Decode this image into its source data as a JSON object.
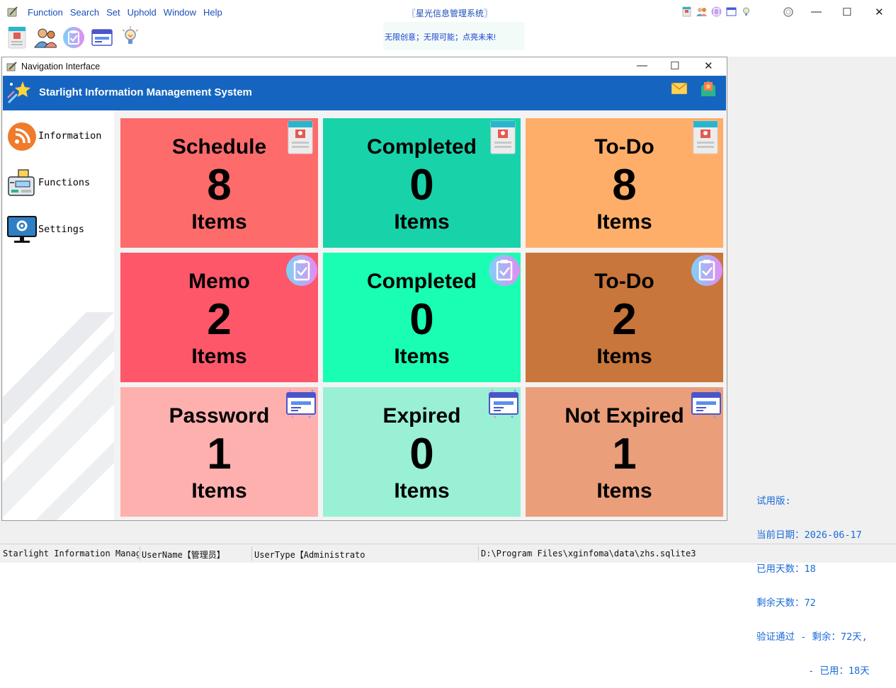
{
  "menu": [
    "Function",
    "Search",
    "Set",
    "Uphold",
    "Window",
    "Help"
  ],
  "app_title": "〖星光信息管理系统〗",
  "slogan": "无限创意；无限可能；点亮未来!",
  "window_controls": {
    "minimize": "—",
    "maximize": "☐",
    "close": "✕"
  },
  "toolbar_icons": [
    "id-card-icon",
    "users-icon",
    "clipboard-check-icon",
    "browser-window-icon",
    "lightbulb-icon"
  ],
  "child": {
    "title": "Navigation Interface",
    "minimize": "—",
    "maximize": "☐",
    "close": "✕"
  },
  "banner": {
    "title": "Starlight Information Management System"
  },
  "sidebar": {
    "items": [
      {
        "label": "Information",
        "icon": "rss-icon"
      },
      {
        "label": "Functions",
        "icon": "functions-icon"
      },
      {
        "label": "Settings",
        "icon": "settings-monitor-icon"
      }
    ]
  },
  "tiles": [
    {
      "title": "Schedule",
      "count": "8",
      "unit": "Items",
      "color": "#fe6b6b",
      "icon": "id-card-icon"
    },
    {
      "title": "Completed",
      "count": "0",
      "unit": "Items",
      "color": "#18d3aa",
      "icon": "id-card-icon"
    },
    {
      "title": "To-Do",
      "count": "8",
      "unit": "Items",
      "color": "#feae69",
      "icon": "id-card-icon"
    },
    {
      "title": "Memo",
      "count": "2",
      "unit": "Items",
      "color": "#fe5769",
      "icon": "clipboard-check-icon"
    },
    {
      "title": "Completed",
      "count": "0",
      "unit": "Items",
      "color": "#19feb3",
      "icon": "clipboard-check-icon"
    },
    {
      "title": "To-Do",
      "count": "2",
      "unit": "Items",
      "color": "#c8763b",
      "icon": "clipboard-check-icon"
    },
    {
      "title": "Password",
      "count": "1",
      "unit": "Items",
      "color": "#feb0af",
      "icon": "browser-window-icon"
    },
    {
      "title": "Expired",
      "count": "0",
      "unit": "Items",
      "color": "#99f0d5",
      "icon": "browser-window-icon"
    },
    {
      "title": "Not Expired",
      "count": "1",
      "unit": "Items",
      "color": "#ea9e7a",
      "icon": "browser-window-icon"
    }
  ],
  "trial": {
    "line1": "试用版:",
    "line2": "当前日期：2026-06-17",
    "line3": "已用天数：18",
    "line4": "剩余天数：72",
    "line5": "验证通过 - 剩余：72天,",
    "line6": "         - 已用：18天"
  },
  "status": {
    "app": "Starlight Information Management System",
    "user": "UserName【管理员】",
    "type": "UserType【Administrator】",
    "path": "D:\\Program Files\\xginfoma\\data\\zhs.sqlite3"
  }
}
